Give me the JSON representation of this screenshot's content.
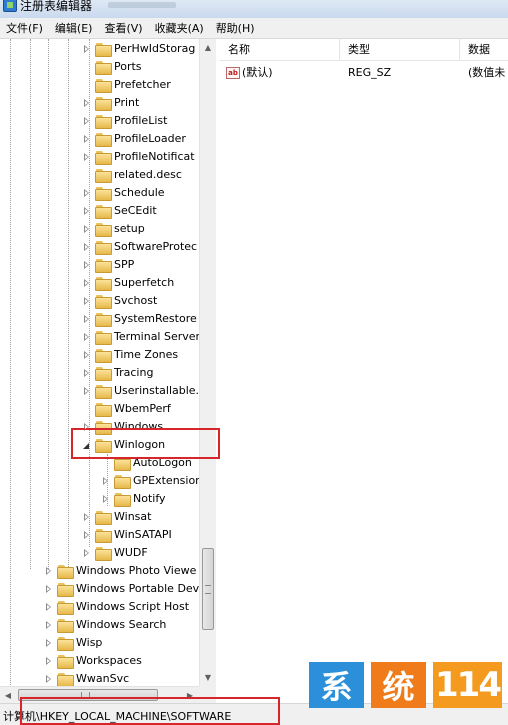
{
  "window": {
    "title": "注册表编辑器"
  },
  "menu": [
    "文件(F)",
    "编辑(E)",
    "查看(V)",
    "收藏夹(A)",
    "帮助(H)"
  ],
  "tree": {
    "items": [
      {
        "label": "PerHwIdStorag",
        "expander": "collapsed",
        "level": 1
      },
      {
        "label": "Ports",
        "expander": "none",
        "level": 1
      },
      {
        "label": "Prefetcher",
        "expander": "none",
        "level": 1
      },
      {
        "label": "Print",
        "expander": "collapsed",
        "level": 1
      },
      {
        "label": "ProfileList",
        "expander": "collapsed",
        "level": 1
      },
      {
        "label": "ProfileLoader",
        "expander": "collapsed",
        "level": 1
      },
      {
        "label": "ProfileNotificat",
        "expander": "collapsed",
        "level": 1
      },
      {
        "label": "related.desc",
        "expander": "none",
        "level": 1
      },
      {
        "label": "Schedule",
        "expander": "collapsed",
        "level": 1
      },
      {
        "label": "SeCEdit",
        "expander": "collapsed",
        "level": 1
      },
      {
        "label": "setup",
        "expander": "collapsed",
        "level": 1
      },
      {
        "label": "SoftwareProtec",
        "expander": "collapsed",
        "level": 1
      },
      {
        "label": "SPP",
        "expander": "collapsed",
        "level": 1
      },
      {
        "label": "Superfetch",
        "expander": "collapsed",
        "level": 1
      },
      {
        "label": "Svchost",
        "expander": "collapsed",
        "level": 1
      },
      {
        "label": "SystemRestore",
        "expander": "collapsed",
        "level": 1
      },
      {
        "label": "Terminal Server",
        "expander": "collapsed",
        "level": 1
      },
      {
        "label": "Time Zones",
        "expander": "collapsed",
        "level": 1
      },
      {
        "label": "Tracing",
        "expander": "collapsed",
        "level": 1
      },
      {
        "label": "Userinstallable.",
        "expander": "collapsed",
        "level": 1
      },
      {
        "label": "WbemPerf",
        "expander": "none",
        "level": 1
      },
      {
        "label": "Windows",
        "expander": "collapsed",
        "level": 1
      },
      {
        "label": "Winlogon",
        "expander": "expanded",
        "level": 1
      },
      {
        "label": "AutoLogon",
        "expander": "none",
        "level": 2
      },
      {
        "label": "GPExtension",
        "expander": "collapsed",
        "level": 2
      },
      {
        "label": "Notify",
        "expander": "collapsed",
        "level": 2
      },
      {
        "label": "Winsat",
        "expander": "collapsed",
        "level": 1
      },
      {
        "label": "WinSATAPI",
        "expander": "collapsed",
        "level": 1
      },
      {
        "label": "WUDF",
        "expander": "collapsed",
        "level": 1
      },
      {
        "label": "Windows Photo Viewe",
        "expander": "collapsed",
        "level": 0
      },
      {
        "label": "Windows Portable Dev",
        "expander": "collapsed",
        "level": 0
      },
      {
        "label": "Windows Script Host",
        "expander": "collapsed",
        "level": 0
      },
      {
        "label": "Windows Search",
        "expander": "collapsed",
        "level": 0
      },
      {
        "label": "Wisp",
        "expander": "collapsed",
        "level": 0
      },
      {
        "label": "Workspaces",
        "expander": "collapsed",
        "level": 0
      },
      {
        "label": "WwanSvc",
        "expander": "collapsed",
        "level": 0
      }
    ]
  },
  "values": {
    "columns": [
      "名称",
      "类型",
      "数据"
    ],
    "rows": [
      {
        "name": "(默认)",
        "type": "REG_SZ",
        "data": "(数值未"
      }
    ]
  },
  "statusbar": {
    "path": "计算机\\HKEY_LOCAL_MACHINE\\SOFTWARE"
  },
  "watermark": {
    "chars": [
      "系",
      "统",
      "114"
    ],
    "colors": [
      "#2b8fd9",
      "#ef7b1a",
      "#f39a1f"
    ]
  },
  "highlight_color": "#d6262b"
}
